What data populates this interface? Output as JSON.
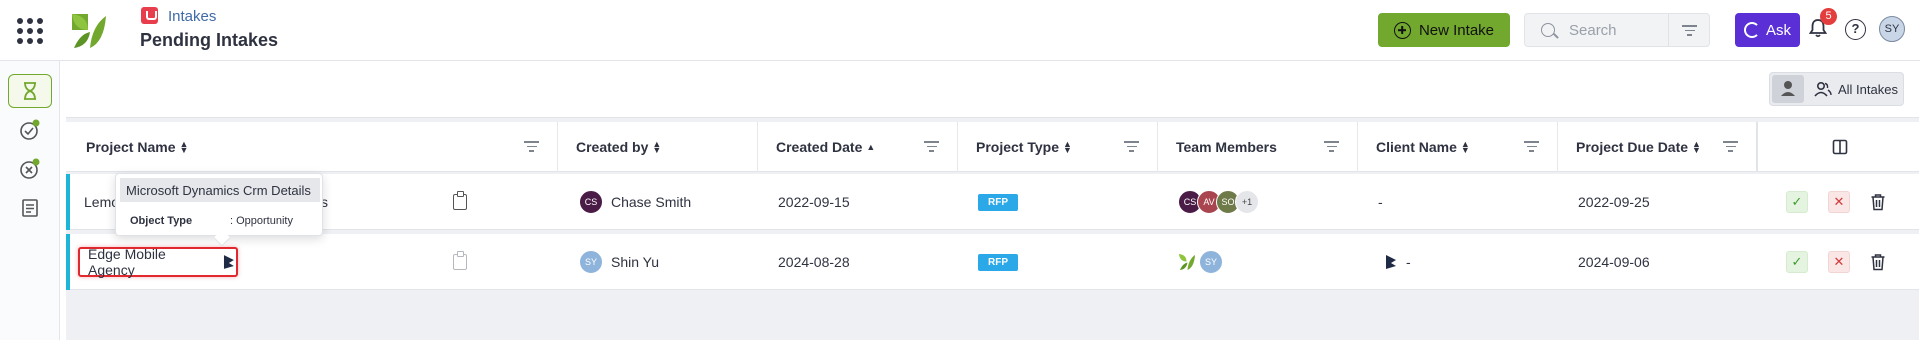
{
  "header": {
    "breadcrumb": "Intakes",
    "title": "Pending Intakes",
    "new_intake_label": "New Intake",
    "search_placeholder": "Search",
    "ask_label": "Ask",
    "notification_count": "5",
    "help_glyph": "?",
    "user_initials": "SY"
  },
  "rail": {
    "items": [
      "hourglass-icon",
      "task-check-icon",
      "intake-status-icon",
      "form-list-icon"
    ]
  },
  "view_toggle": {
    "all_label": "All Intakes"
  },
  "table": {
    "columns": [
      {
        "label": "Project Name"
      },
      {
        "label": "Created by"
      },
      {
        "label": "Created Date"
      },
      {
        "label": "Project Type"
      },
      {
        "label": "Team Members"
      },
      {
        "label": "Client Name"
      },
      {
        "label": "Project Due Date"
      }
    ],
    "rows": [
      {
        "project_name_visible": "Lemo",
        "project_name_tail": "s",
        "created_by_initials": "CS",
        "created_by": "Chase Smith",
        "created_date": "2022-09-15",
        "project_type": "RFP",
        "team": [
          "CS",
          "AV",
          "SO"
        ],
        "team_more": "+1",
        "client_name": "-",
        "due_date": "2022-09-25"
      },
      {
        "project_name": "Edge Mobile Agency",
        "created_by_initials": "SY",
        "created_by": "Shin Yu",
        "created_date": "2024-08-28",
        "project_type": "RFP",
        "team": [
          "SY"
        ],
        "client_name": "-",
        "due_date": "2024-09-06"
      }
    ]
  },
  "tooltip": {
    "title": "Microsoft Dynamics Crm Details",
    "key": "Object Type",
    "value": ": Opportunity"
  },
  "colors": {
    "brand_green": "#71a82d",
    "ask_purple": "#5a2fd6",
    "rfp_blue": "#2aa8e8",
    "row_accent": "#1fb5d6",
    "highlight_red": "#e0282e"
  }
}
